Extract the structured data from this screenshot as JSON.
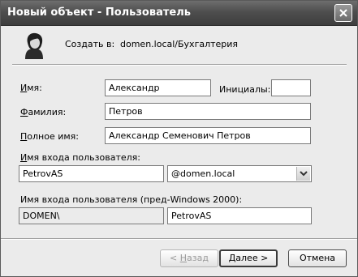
{
  "window": {
    "title": "Новый объект - Пользователь"
  },
  "header": {
    "create_in_label": "Создать в:",
    "create_in_path": "domen.local/Бухгалтерия"
  },
  "form": {
    "first_name": {
      "label_accel": "И",
      "label_rest": "мя:",
      "value": "Александр"
    },
    "initials": {
      "label": "Инициалы:",
      "value": ""
    },
    "last_name": {
      "label_accel": "Ф",
      "label_rest": "амилия:",
      "value": "Петров"
    },
    "full_name": {
      "label_accel": "П",
      "label_rest": "олное имя:",
      "value": "Александр Семенович Петров"
    },
    "logon_name": {
      "label_accel": "И",
      "label_rest": "мя входа пользователя:",
      "value": "PetrovAS",
      "domain_selected": "@domen.local"
    },
    "logon_pre2000": {
      "label": "Имя входа пользователя (пред-Windows 2000):",
      "domain_value": "DOMEN\\",
      "value": "PetrovAS"
    }
  },
  "buttons": {
    "back": {
      "symbol": "<",
      "accel": "Н",
      "rest": "азад"
    },
    "next": {
      "accel": "Д",
      "rest": "алее",
      "symbol": ">"
    },
    "cancel": {
      "label": "Отмена"
    }
  },
  "icons": {
    "close": "close-icon",
    "user": "user-icon",
    "dropdown": "chevron-down-icon"
  }
}
